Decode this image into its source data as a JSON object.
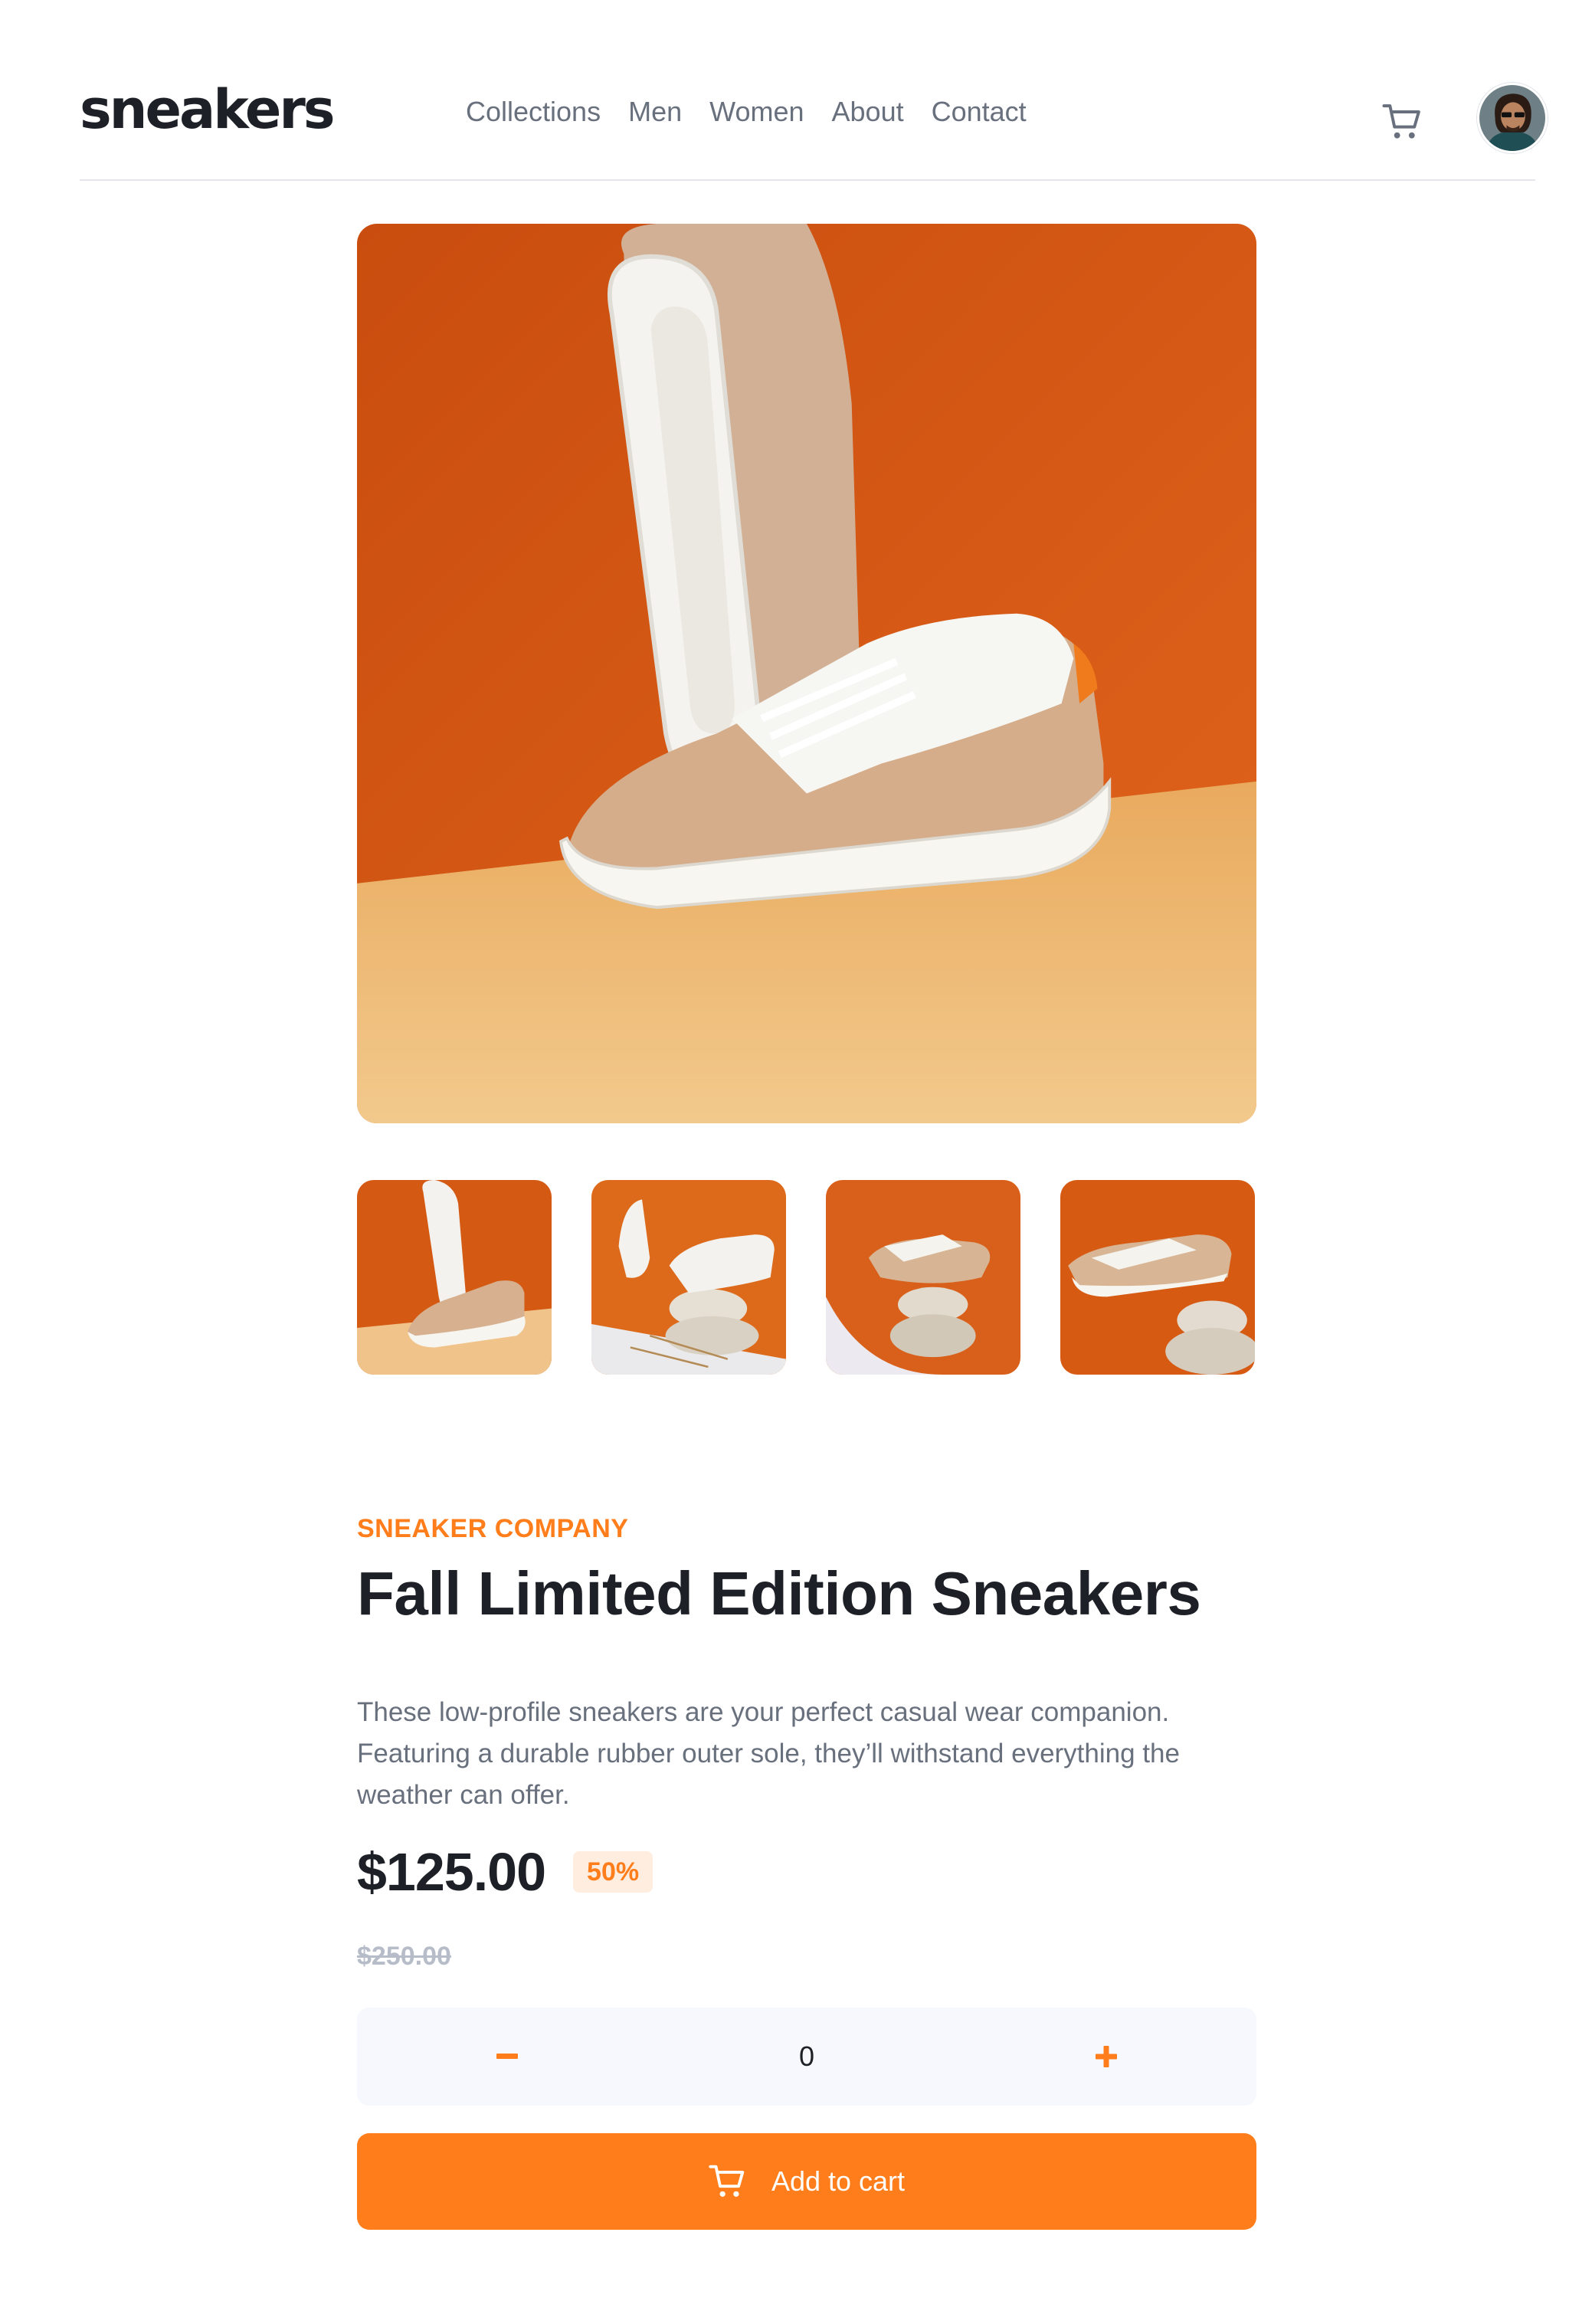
{
  "header": {
    "logo": "sneakers",
    "nav": [
      "Collections",
      "Men",
      "Women",
      "About",
      "Contact"
    ],
    "icons": {
      "cart": "cart-icon",
      "avatar": "avatar"
    }
  },
  "gallery": {
    "thumbnails": 4,
    "selected": 1
  },
  "product": {
    "company": "SNEAKER COMPANY",
    "title": "Fall Limited Edition Sneakers",
    "description": "These low-profile sneakers are your perfect casual wear companion. Featuring a durable rubber outer sole, they’ll withstand everything the weather can offer.",
    "price": "$125.00",
    "discount": "50%",
    "old_price": "$250.00",
    "quantity": "0",
    "add_to_cart": "Add to cart"
  },
  "colors": {
    "accent": "#ff7d1a",
    "pale_orange": "#ffede0",
    "dark": "#1d2026",
    "grayish_blue": "#69707d"
  }
}
